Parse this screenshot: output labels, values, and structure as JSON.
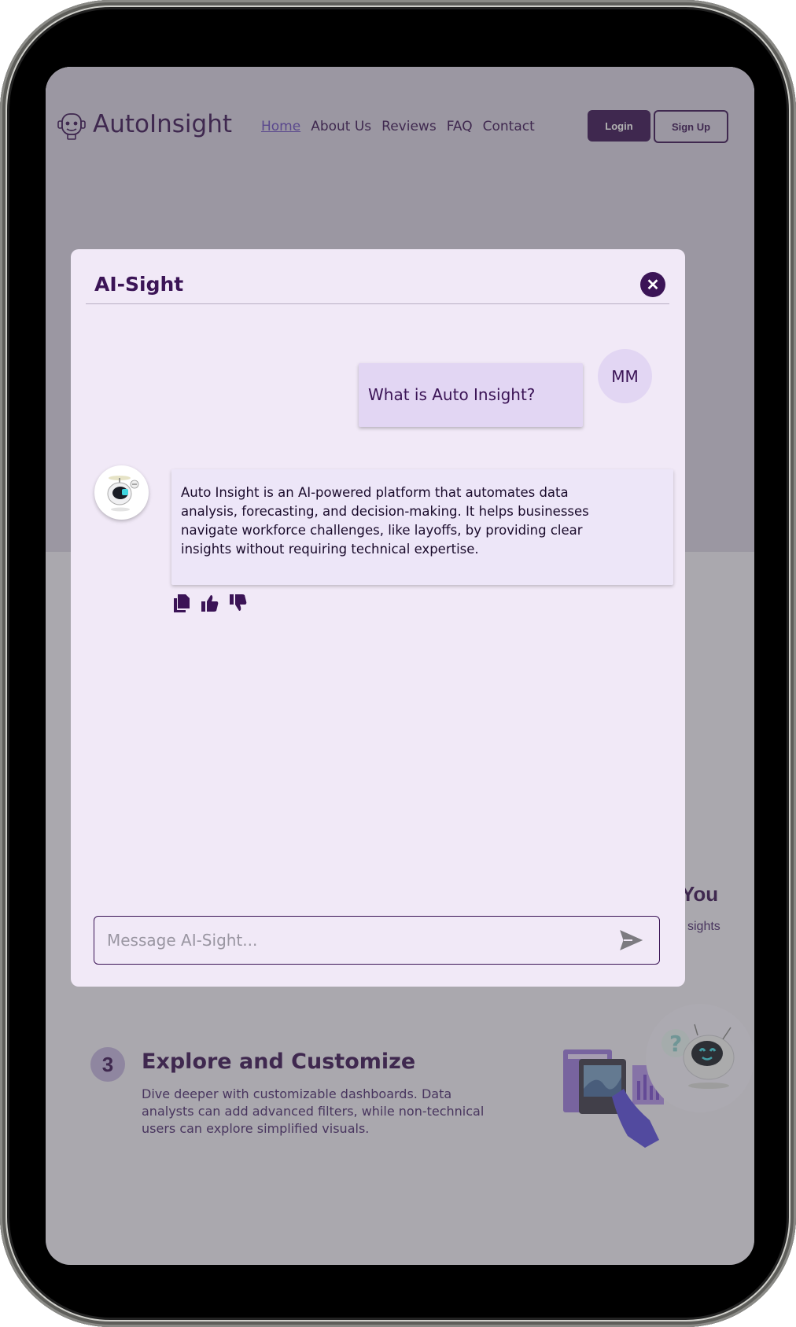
{
  "page": {
    "logo_text": "AutoInsight",
    "nav": [
      {
        "label": "Home"
      },
      {
        "label": "About Us"
      },
      {
        "label": "Reviews"
      },
      {
        "label": "FAQ"
      },
      {
        "label": "Contact"
      }
    ],
    "login_label": "Login",
    "signup_label": "Sign Up",
    "partial_heading": "You",
    "partial_text": "sights",
    "step": {
      "number": "3",
      "title": "Explore and Customize",
      "text": "Dive deeper with customizable dashboards. Data analysts can add advanced filters, while non-technical users can explore simplified visuals."
    }
  },
  "chat": {
    "title": "AI-Sight",
    "close_icon": "close-icon",
    "user_initials": "MM",
    "user_message": "What is Auto Insight?",
    "bot_message": "Auto Insight is an AI-powered platform that automates data analysis, forecasting, and decision-making. It helps businesses navigate workforce challenges, like layoffs, by providing clear insights without requiring technical expertise.",
    "actions": [
      "copy-icon",
      "thumbs-up-icon",
      "thumbs-down-icon"
    ],
    "input_placeholder": "Message AI-Sight...",
    "input_value": ""
  },
  "colors": {
    "brand": "#3b1456",
    "accent": "#6a4bc2",
    "modal_bg": "#f1e9f7",
    "user_bubble": "#e2d6f3"
  }
}
